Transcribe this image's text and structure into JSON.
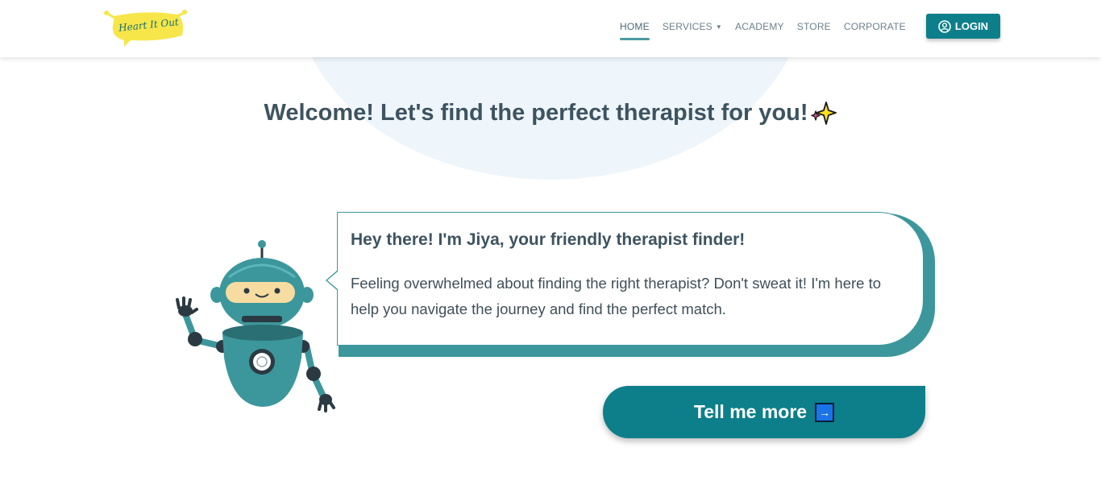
{
  "brand": {
    "logo_text": "Heart It Out"
  },
  "nav": {
    "items": [
      {
        "label": "HOME",
        "active": true
      },
      {
        "label": "SERVICES",
        "has_dropdown": true
      },
      {
        "label": "ACADEMY"
      },
      {
        "label": "STORE"
      },
      {
        "label": "CORPORATE"
      }
    ],
    "login_label": "LOGIN"
  },
  "hero": {
    "welcome": "Welcome! Let's find the perfect therapist for you!"
  },
  "bubble": {
    "title": "Hey there! I'm Jiya, your friendly therapist finder!",
    "body": "Feeling overwhelmed about finding the right therapist? Don't sweat it! I'm here to help you navigate the journey and find the perfect match."
  },
  "cta": {
    "label": "Tell me more",
    "arrow": "→"
  },
  "colors": {
    "primary": "#0d7f8a",
    "accent": "#3c979c",
    "logo_yellow": "#f7e64a",
    "text_dark": "#3d5360"
  },
  "icons": {
    "login": "user-circle-icon",
    "sparkle": "sparkles-icon",
    "cta_arrow": "right-arrow-icon"
  }
}
